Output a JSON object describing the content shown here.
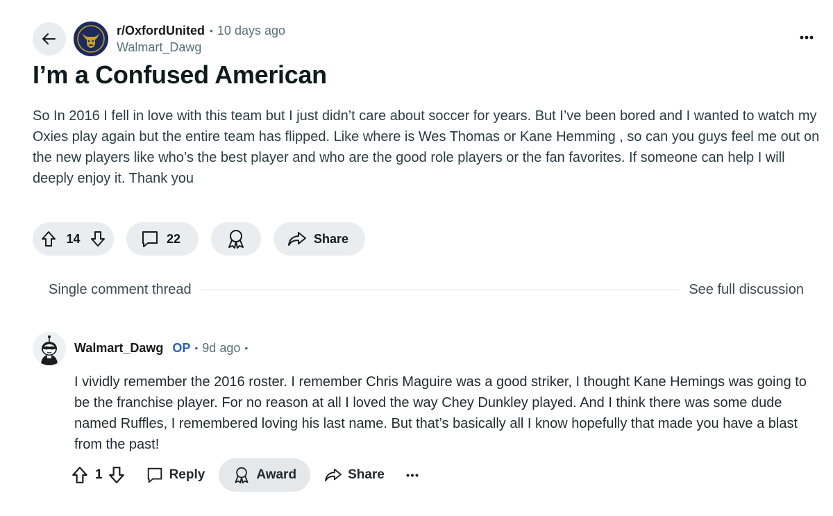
{
  "header": {
    "subreddit": "r/OxfordUnited",
    "time_ago": "10 days ago",
    "author": "Walmart_Dawg"
  },
  "post": {
    "title": "I’m a Confused American",
    "body": "So In 2016 I fell in love with this team but I just didn’t care about soccer for years. But I’ve been bored and I wanted to watch my Oxies play again but the entire team has flipped. Like where is Wes Thomas or Kane Hemming , so can you guys feel me out on the new players like who’s the best player and who are the good role players or the fan favorites. If someone can help I will deeply enjoy it. Thank you",
    "vote_count": "14",
    "comment_count": "22",
    "share_label": "Share"
  },
  "thread": {
    "label": "Single comment thread",
    "full_discussion_link": "See full discussion"
  },
  "comment": {
    "author": "Walmart_Dawg",
    "op_badge": "OP",
    "time_ago": "9d ago",
    "body": "I vividly remember the 2016 roster. I remember Chris Maguire was a good striker, I thought Kane Hemings was going to be the franchise player. For no reason at all I loved the way Chey Dunkley played. And I think there was some dude named Ruffles, I remembered loving his last name. But that’s basically all I know hopefully that made you have a blast from the past!",
    "vote_count": "1",
    "reply_label": "Reply",
    "award_label": "Award",
    "share_label": "Share"
  },
  "icons": {
    "back": "arrow-left-icon",
    "more": "ellipsis-icon",
    "upvote": "arrow-up-icon",
    "downvote": "arrow-down-icon",
    "comment": "speech-bubble-icon",
    "award": "award-ribbon-icon",
    "share": "share-arrow-icon"
  },
  "colors": {
    "pill_background": "#eaedef",
    "op_badge": "#2d5fb3",
    "meta_text": "#576f76"
  }
}
